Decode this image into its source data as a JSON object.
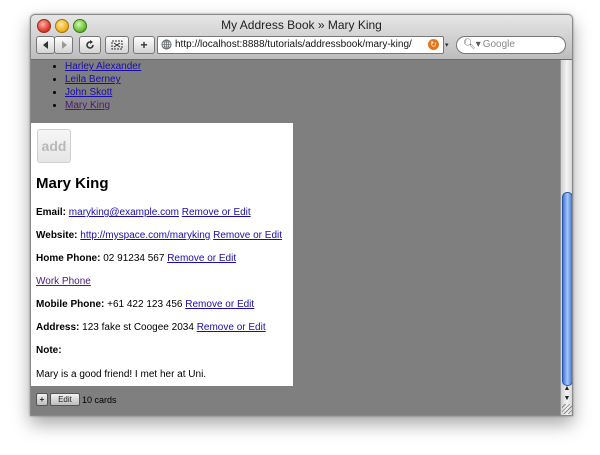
{
  "window": {
    "title": "My Address Book » Mary King"
  },
  "toolbar": {
    "back_icon": "back-arrow-icon",
    "forward_icon": "forward-arrow-icon",
    "reload_icon": "reload-icon",
    "snippet_icon": "web-clip-icon",
    "add_bookmark_label": "+",
    "url": "http://localhost:8888/tutorials/addressbook/mary-king/",
    "search_placeholder": "Google"
  },
  "nav": {
    "items": [
      {
        "label": "Harley Alexander"
      },
      {
        "label": "Leila Berney"
      },
      {
        "label": "John Skott"
      },
      {
        "label": "Mary King"
      }
    ]
  },
  "card": {
    "photo_placeholder": "add",
    "name": "Mary King",
    "email_label": "Email:",
    "email_value": "maryking@example.com",
    "website_label": "Website:",
    "website_value": "http://myspace.com/maryking",
    "home_phone_label": "Home Phone:",
    "home_phone_value": "02 91234 567",
    "work_phone_link": "Work Phone",
    "mobile_phone_label": "Mobile Phone:",
    "mobile_phone_value": "+61 422 123 456",
    "address_label": "Address:",
    "address_value": "123 fake st Coogee 2034",
    "note_label": "Note:",
    "note_value": "Mary is a good friend! I met her at Uni.",
    "remove_or_edit": "Remove or Edit"
  },
  "footer": {
    "add_label": "+",
    "edit_label": "Edit",
    "card_count": "10 cards"
  },
  "colors": {
    "link": "#1a0dab",
    "visited_link": "#4b1a7a",
    "page_background": "#7f7f7f",
    "scroll_thumb": "#3f74d8"
  }
}
